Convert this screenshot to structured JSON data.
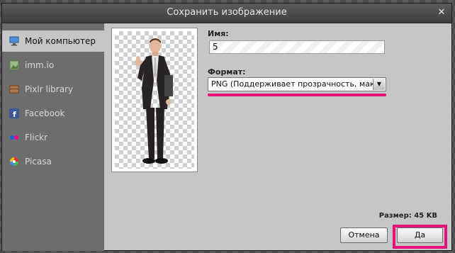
{
  "dialog": {
    "title": "Сохранить изображение",
    "close_icon": "close-icon"
  },
  "sidebar": {
    "items": [
      {
        "label": "Мой компьютер",
        "icon": "computer-icon",
        "color": "#4a8fd6"
      },
      {
        "label": "imm.io",
        "icon": "image-icon",
        "color": "#8fb37a"
      },
      {
        "label": "Pixlr library",
        "icon": "library-icon",
        "color": "#b07a4a"
      },
      {
        "label": "Facebook",
        "icon": "facebook-icon",
        "color": "#3b5998"
      },
      {
        "label": "Flickr",
        "icon": "flickr-icon",
        "color": "#ff0084"
      },
      {
        "label": "Picasa",
        "icon": "picasa-icon",
        "color": "#d94a3a"
      }
    ]
  },
  "form": {
    "name_label": "Имя:",
    "name_value": "5",
    "format_label": "Формат:",
    "format_value": "PNG (Поддерживает прозрачность, макс"
  },
  "footer": {
    "size_text": "Размер: 45 KB",
    "cancel_label": "Отмена",
    "ok_label": "Да"
  },
  "colors": {
    "highlight": "#e6127a"
  }
}
